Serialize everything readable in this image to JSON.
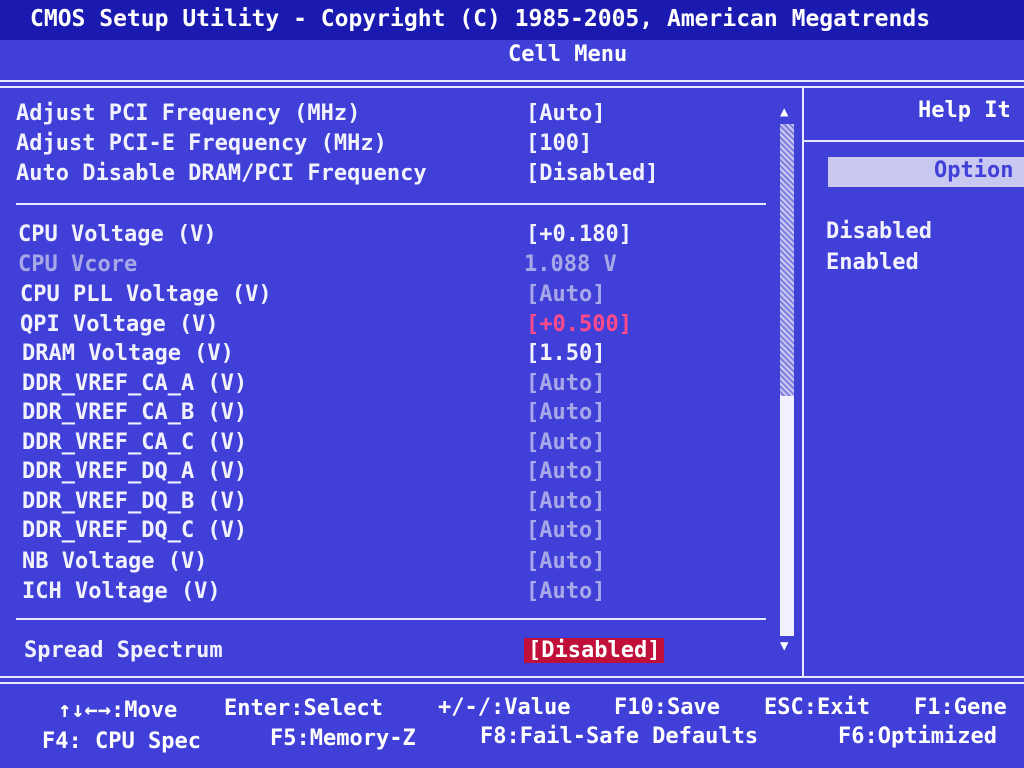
{
  "header": {
    "title": "CMOS Setup Utility - Copyright (C) 1985-2005, American Megatrends",
    "subtitle": "Cell Menu"
  },
  "settings_top": [
    {
      "label": "Adjust PCI Frequency (MHz)",
      "value": "[Auto]"
    },
    {
      "label": "Adjust PCI-E Frequency (MHz)",
      "value": "[100]"
    },
    {
      "label": "Auto Disable DRAM/PCI Frequency",
      "value": "[Disabled]"
    }
  ],
  "settings_voltage": [
    {
      "label": "CPU Voltage (V)",
      "value": "[+0.180]"
    },
    {
      "label": "CPU Vcore",
      "value": "1.088 V"
    },
    {
      "label": "CPU PLL Voltage (V)",
      "value": "[Auto]"
    },
    {
      "label": "QPI Voltage (V)",
      "value": "[+0.500]"
    },
    {
      "label": "DRAM Voltage (V)",
      "value": "[1.50]"
    },
    {
      "label": "DDR_VREF_CA_A (V)",
      "value": "[Auto]"
    },
    {
      "label": "DDR_VREF_CA_B (V)",
      "value": "[Auto]"
    },
    {
      "label": "DDR_VREF_CA_C (V)",
      "value": "[Auto]"
    },
    {
      "label": "DDR_VREF_DQ_A (V)",
      "value": "[Auto]"
    },
    {
      "label": "DDR_VREF_DQ_B (V)",
      "value": "[Auto]"
    },
    {
      "label": "DDR_VREF_DQ_C (V)",
      "value": "[Auto]"
    },
    {
      "label": "NB Voltage (V)",
      "value": "[Auto]"
    },
    {
      "label": "ICH Voltage (V)",
      "value": "[Auto]"
    }
  ],
  "settings_bottom": [
    {
      "label": "Spread Spectrum",
      "value": "[Disabled]"
    }
  ],
  "help_panel": {
    "title": "Help It",
    "options_header": "Option",
    "options": [
      "Disabled",
      "Enabled"
    ]
  },
  "footer": {
    "line1": [
      "↑↓←→:Move",
      "Enter:Select",
      "+/-/:Value",
      "F10:Save",
      "ESC:Exit",
      "F1:Gene"
    ],
    "line2": [
      "F4: CPU Spec",
      "F5:Memory-Z",
      "F8:Fail-Safe Defaults",
      "F6:Optimized"
    ]
  },
  "colors": {
    "background": "#4040d8",
    "title_bar": "#1a1ab0",
    "highlight": "#c0103a",
    "warning_value": "#ff4a8a",
    "disabled_text": "#a8a8e8"
  },
  "icons": {
    "scroll_up": "triangle-up-icon",
    "scroll_down": "triangle-down-icon"
  }
}
